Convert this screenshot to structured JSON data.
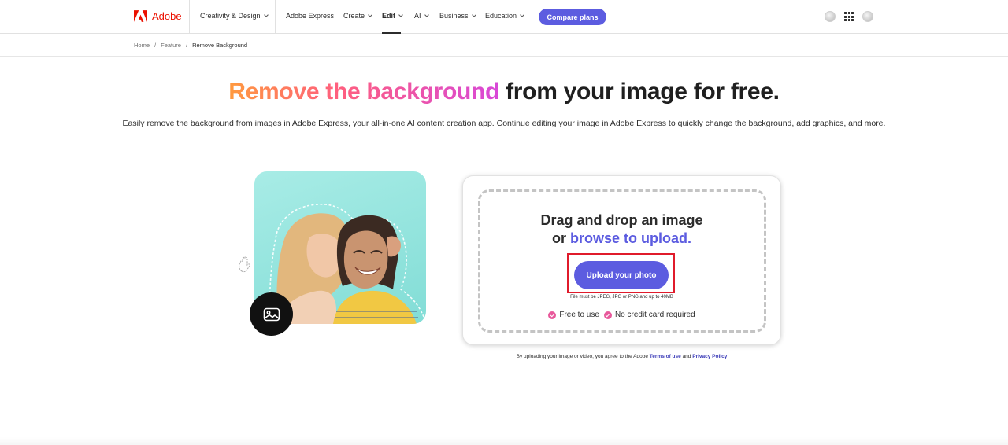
{
  "brand": {
    "name": "Adobe",
    "logo_icon": "adobe-logo-icon",
    "color": "#eb1000"
  },
  "nav": {
    "items": [
      {
        "label": "Creativity & Design",
        "dropdown": true
      },
      {
        "label": "Adobe Express",
        "dropdown": false
      },
      {
        "label": "Create",
        "dropdown": true
      },
      {
        "label": "Edit",
        "dropdown": true,
        "active": true
      },
      {
        "label": "AI",
        "dropdown": true
      },
      {
        "label": "Business",
        "dropdown": true
      },
      {
        "label": "Education",
        "dropdown": true
      }
    ],
    "cta": "Compare plans",
    "cta_color": "#5c5ce0",
    "right_icons": [
      "profile-dot-icon",
      "apps-grid-icon",
      "avatar-icon"
    ]
  },
  "breadcrumb": {
    "items": [
      "Home",
      "Feature",
      "Remove Background"
    ],
    "separator": "/"
  },
  "hero": {
    "title_highlight": "Remove the background",
    "title_rest": " from your image for free.",
    "subtitle": "Easily remove the background from images in Adobe Express, your all-in-one AI content creation app. Continue editing your image in Adobe Express to quickly change the background, add graphics, and more."
  },
  "upload": {
    "title_line1": "Drag and drop an image",
    "title_line2_prefix": "or ",
    "title_line2_link": "browse to upload.",
    "button": "Upload your photo",
    "file_note": "File must be JPEG, JPG or PNG and up to 40MB",
    "perks": [
      "Free to use",
      "No credit card required"
    ],
    "accent": "#5c5ce0",
    "highlight_color": "#e01b2b"
  },
  "terms": {
    "prefix": "By uploading your image or video, you agree to the Adobe ",
    "terms_link": "Terms of use",
    "and": " and ",
    "privacy_link": "Privacy Policy"
  },
  "illustration": {
    "badge_icon": "image-icon",
    "hand_icon": "hand-icon"
  }
}
